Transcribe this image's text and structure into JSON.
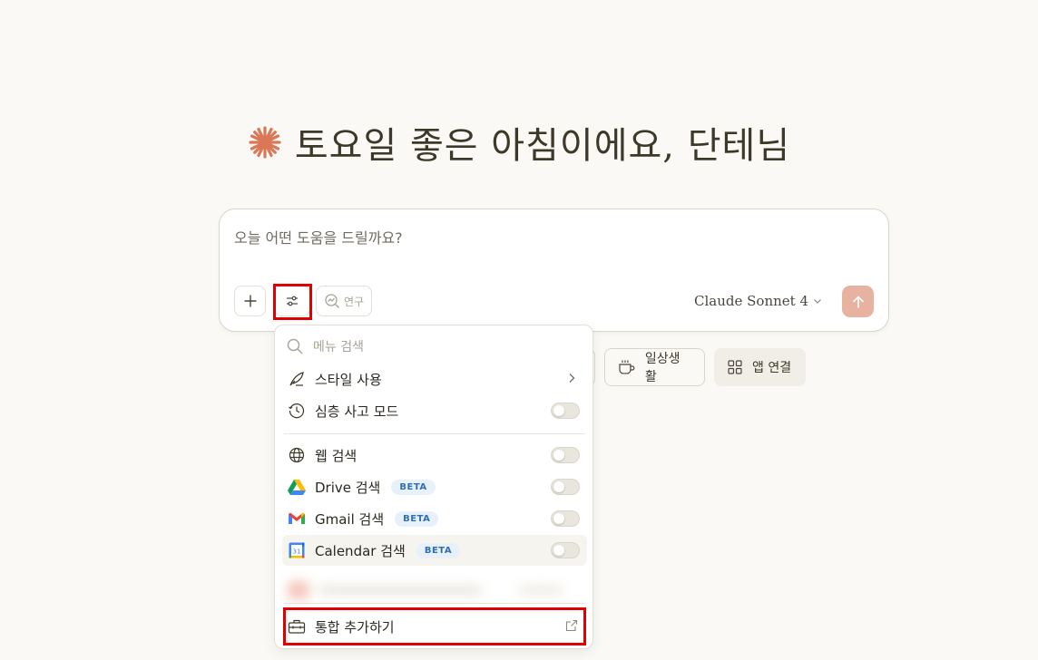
{
  "greeting": {
    "text": "토요일 좋은 아침이에요, 단테님"
  },
  "composer": {
    "placeholder": "오늘 어떤 도움을 드릴까요?",
    "research_label": "연구",
    "model": "Claude Sonnet 4"
  },
  "chips": {
    "daily": "일상생활",
    "apps": "앱 연결"
  },
  "menu": {
    "search_placeholder": "메뉴 검색",
    "style": "스타일 사용",
    "deep_thinking": "심층 사고 모드",
    "web_search": "웹 검색",
    "drive": "Drive 검색",
    "gmail": "Gmail 검색",
    "calendar": "Calendar 검색",
    "calendar_day": "31",
    "beta": "BETA",
    "add_integration": "통합 추가하기"
  },
  "colors": {
    "accent": "#d97757",
    "send_button": "#e8b2a1",
    "highlight": "#e00000",
    "background": "#faf9f5"
  }
}
